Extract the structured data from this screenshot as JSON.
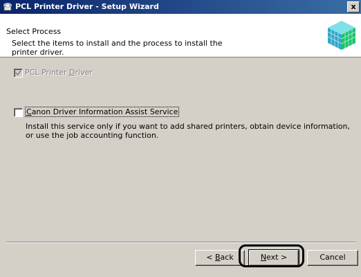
{
  "window": {
    "title": "PCL Printer Driver - Setup Wizard",
    "close_glyph": "x"
  },
  "header": {
    "title": "Select Process",
    "description": "Select the items to install and the process to install the printer driver."
  },
  "options": [
    {
      "label_pre": "PCL Printer ",
      "label_access": "D",
      "label_post": "river",
      "checked": true,
      "disabled": true
    },
    {
      "label_pre": "",
      "label_access": "C",
      "label_post": "anon Driver Information Assist Service",
      "checked": false,
      "disabled": false,
      "description": "Install this service only if you want to add shared printers, obtain device information, or use the job accounting function."
    }
  ],
  "buttons": {
    "back": {
      "pre": "< ",
      "access": "B",
      "post": "ack"
    },
    "next": {
      "pre": "",
      "access": "N",
      "post": "ext >"
    },
    "cancel": "Cancel"
  },
  "colors": {
    "titlebar_start": "#0a246a",
    "titlebar_end": "#3a6ea5",
    "dialog_bg": "#d4d0c8"
  }
}
